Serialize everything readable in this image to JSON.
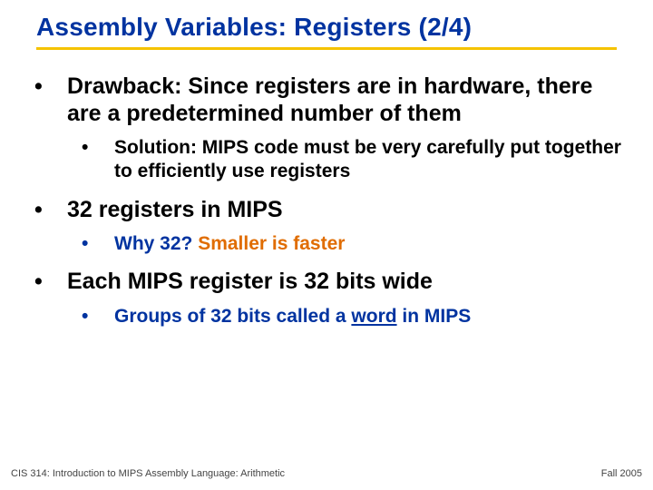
{
  "title": "Assembly Variables: Registers (2/4)",
  "bullets": {
    "b1": "Drawback: Since registers are in hardware, there are a predetermined number of them",
    "b1a": "Solution: MIPS code must be very carefully put together to efficiently use registers",
    "b2": "32 registers in MIPS",
    "b2a_prefix": "Why 32? ",
    "b2a_orange": "Smaller is faster",
    "b3": "Each MIPS register is 32 bits wide",
    "b3a_prefix": "Groups of 32 bits called a ",
    "b3a_word": "word",
    "b3a_suffix": " in MIPS"
  },
  "footer": {
    "left": "CIS 314: Introduction to MIPS Assembly Language: Arithmetic",
    "right": "Fall 2005"
  }
}
